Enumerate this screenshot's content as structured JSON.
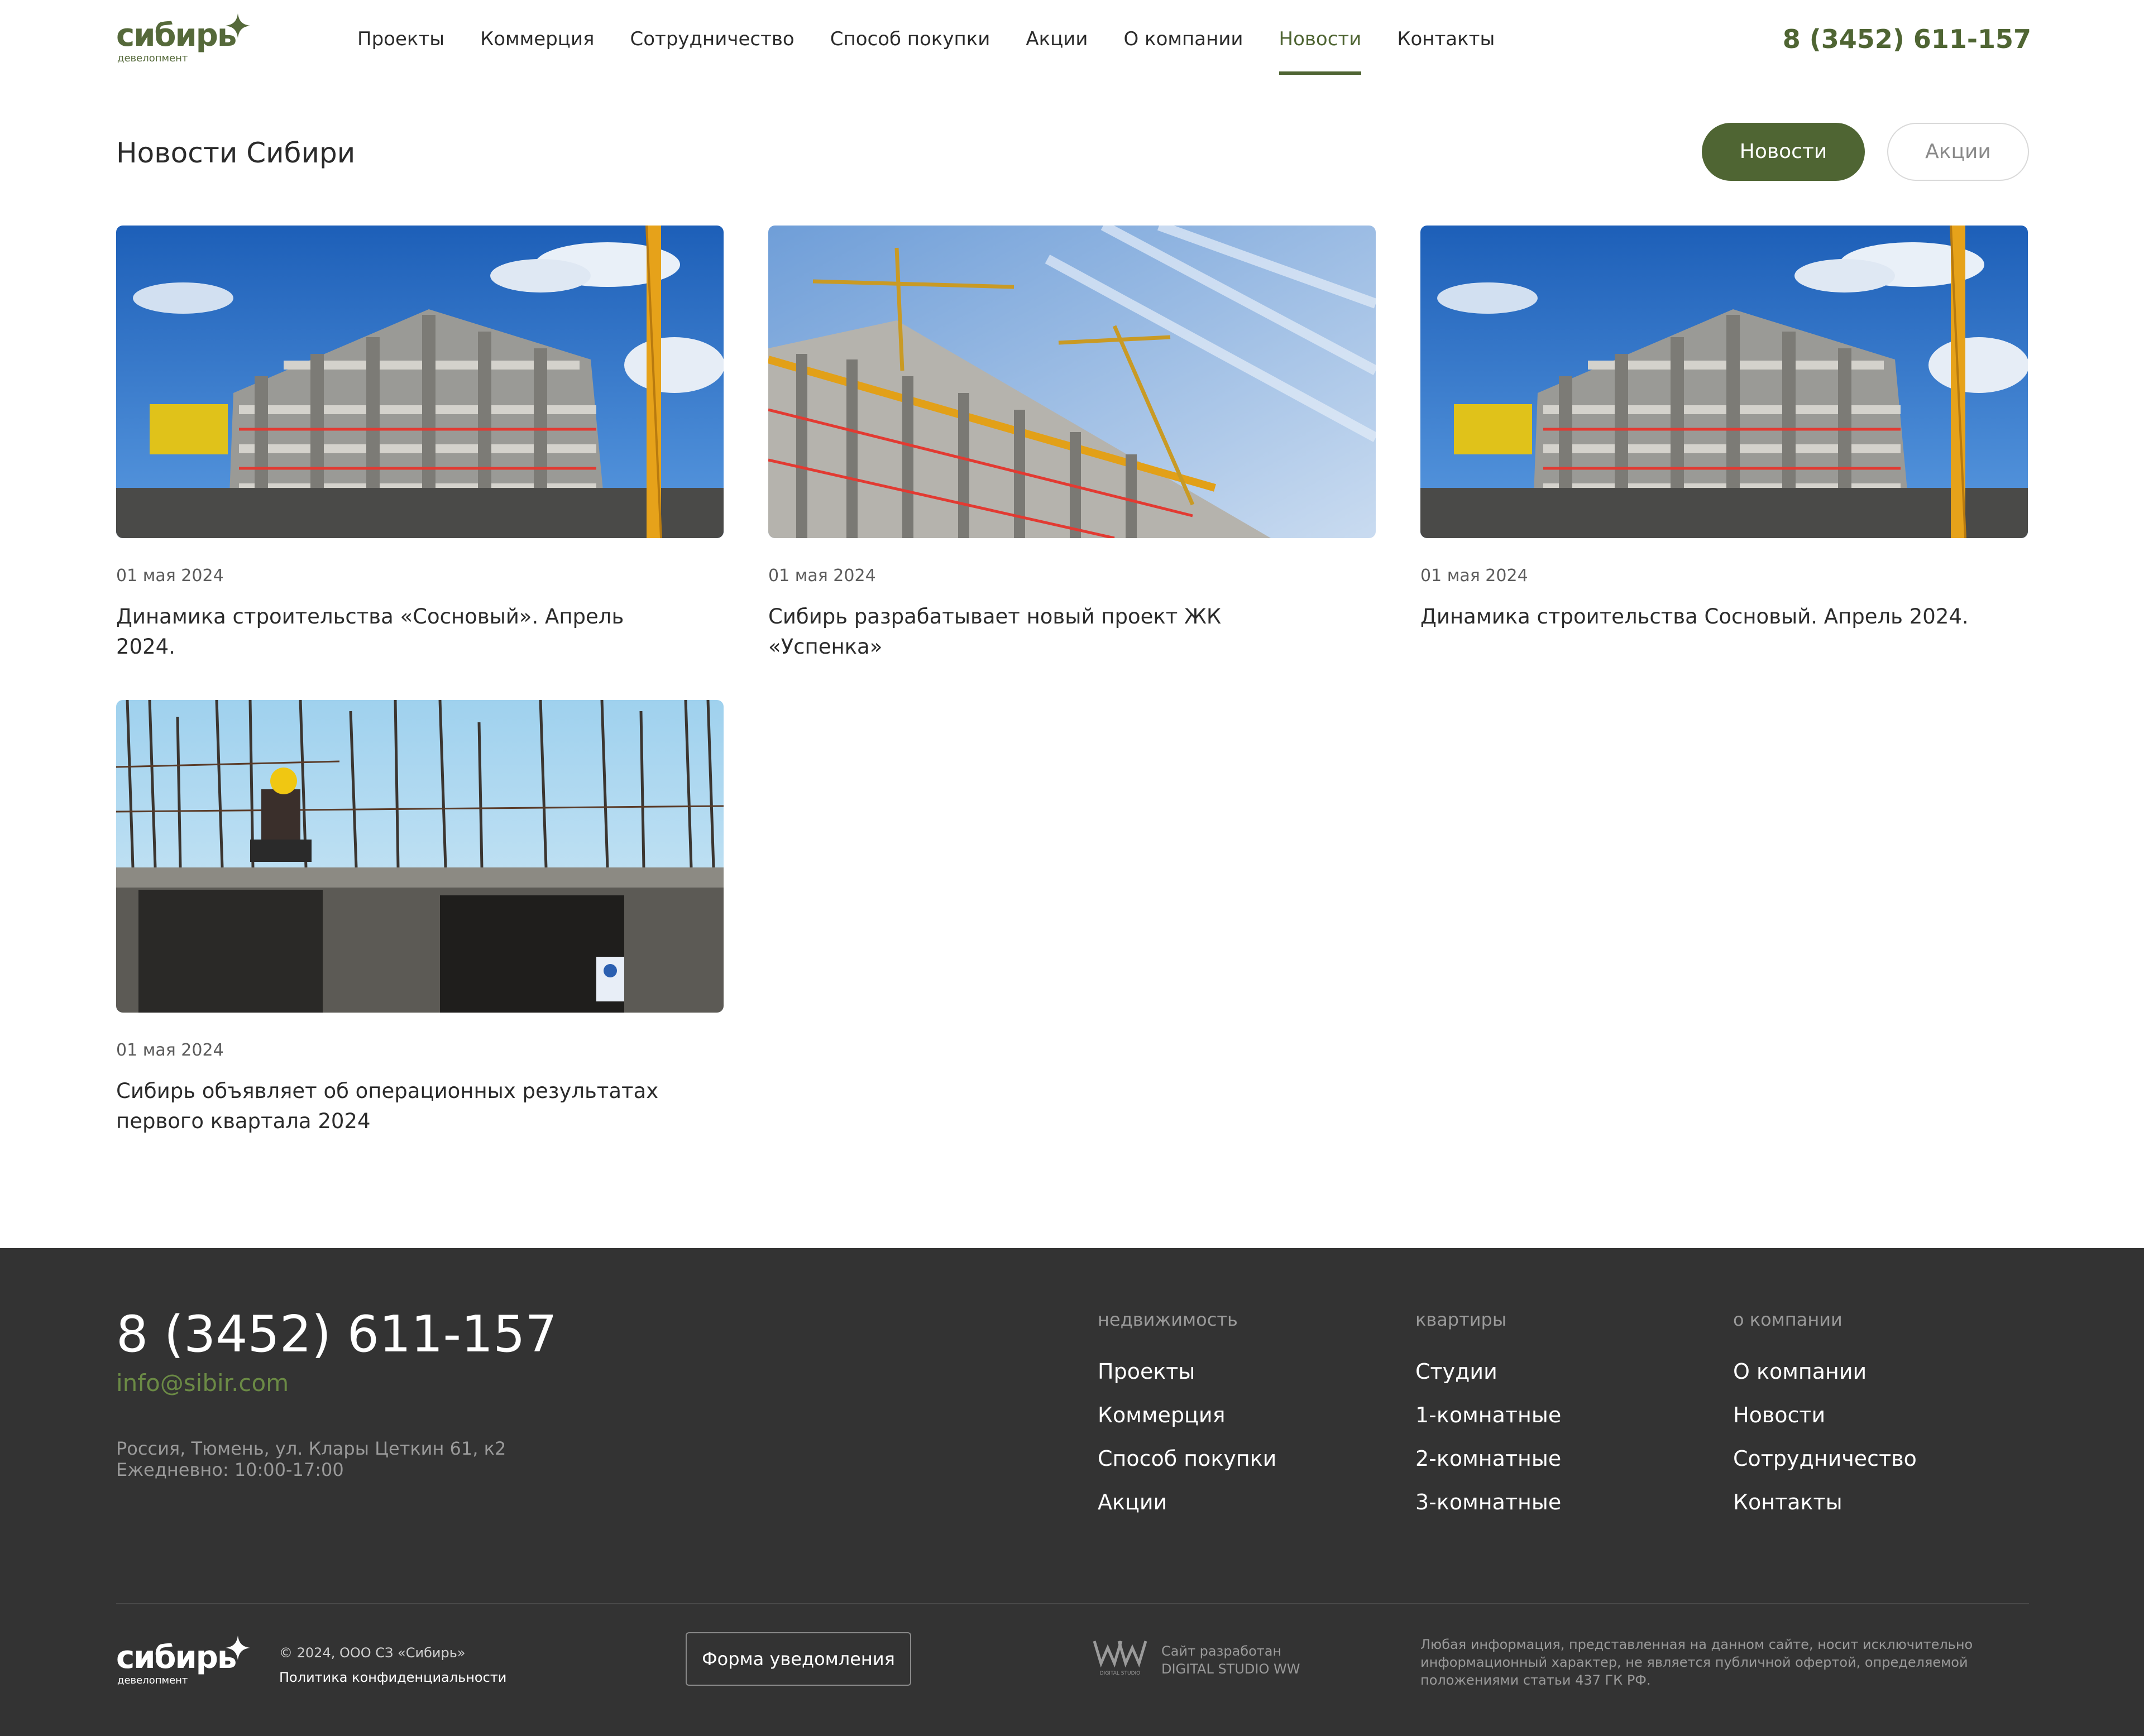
{
  "brand": {
    "logo_word": "сибирь",
    "logo_sub": "девелопмент",
    "accent_color": "#4f6533",
    "email_color": "#6b8a45"
  },
  "nav": {
    "items": [
      {
        "label": "Проекты",
        "active": false
      },
      {
        "label": "Коммерция",
        "active": false
      },
      {
        "label": "Сотрудничество",
        "active": false
      },
      {
        "label": "Способ покупки",
        "active": false
      },
      {
        "label": "Акции",
        "active": false
      },
      {
        "label": "О компании",
        "active": false
      },
      {
        "label": "Новости",
        "active": true
      },
      {
        "label": "Контакты",
        "active": false
      }
    ],
    "phone": "8 (3452) 611-157"
  },
  "page": {
    "title": "Новости Сибири",
    "filters": {
      "news": "Новости",
      "promo": "Акции",
      "selected": "Новости"
    }
  },
  "news": [
    {
      "date": "01 мая 2024",
      "title": "Динамика строительства «Сосновый». Апрель 2024.",
      "image": "construction-building-crane-photo"
    },
    {
      "date": "01 мая 2024",
      "title": "Сибирь разрабатывает новый проект ЖК «Успенка»",
      "image": "construction-cranes-sky-photo"
    },
    {
      "date": "01 мая 2024",
      "title": "Динамика строительства Сосновый. Апрель 2024.",
      "image": "construction-building-crane-photo"
    },
    {
      "date": "01 мая 2024",
      "title": "Сибирь объявляет об операционных результатах первого квартала 2024",
      "image": "construction-worker-rebar-photo"
    }
  ],
  "footer": {
    "phone": "8 (3452) 611-157",
    "email": "info@sibir.com",
    "address": "Россия, Тюмень, ул. Клары Цеткин 61, к2",
    "hours": "Ежедневно: 10:00-17:00",
    "columns": [
      {
        "heading": "недвижимость",
        "links": [
          "Проекты",
          "Коммерция",
          "Способ покупки",
          "Акции"
        ]
      },
      {
        "heading": "квартиры",
        "links": [
          "Студии",
          "1-комнатные",
          "2-комнатные",
          "3-комнатные"
        ]
      },
      {
        "heading": "о компании",
        "links": [
          "О компании",
          "Новости",
          "Сотрудничество",
          "Контакты"
        ]
      }
    ],
    "copyright": "© 2024, ООО СЗ «Сибирь»",
    "policy": "Политика конфиденциальности",
    "form_button": "Форма уведомления",
    "studio_line1": "Сайт разработан",
    "studio_line2": "DIGITAL STUDIO WW",
    "studio_logo_caption": "DIGITAL STUDIO",
    "legal": "Любая информация, представленная на данном сайте, носит исключительно информационный характер, не является публичной офертой, определяемой положениями статьи 437 ГК РФ."
  }
}
